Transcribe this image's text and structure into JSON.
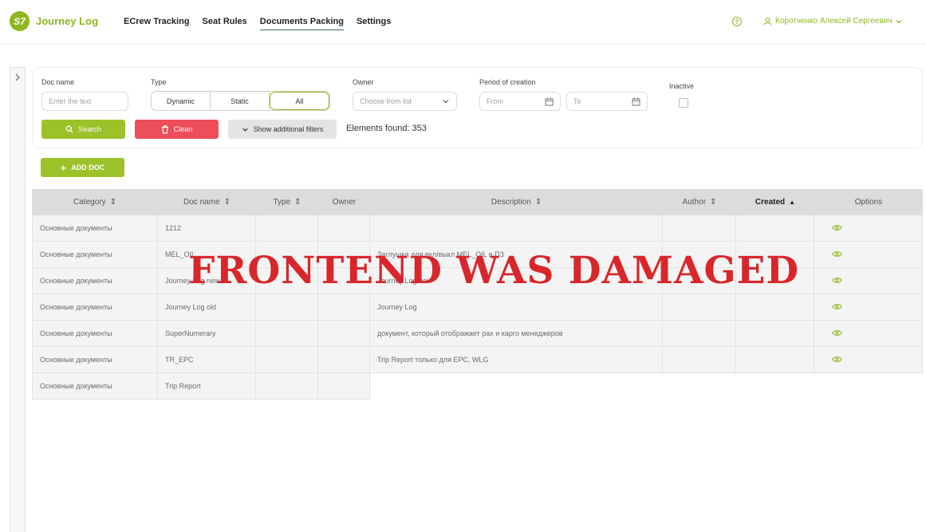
{
  "header": {
    "logo": "S7",
    "app_title": "Journey Log",
    "nav": [
      "ECrew Tracking",
      "Seat Rules",
      "Documents Packing",
      "Settings"
    ],
    "active_nav": "Documents Packing",
    "help_icon": "?",
    "user_name": "Коротченко Алексей Сергеевич",
    "brand_color": "#8cb81e"
  },
  "filters": {
    "doc_name_label": "Doc name",
    "doc_name_placeholder": "Enter the text",
    "type_label": "Type",
    "type_options": [
      "Dynamic",
      "Static",
      "All"
    ],
    "type_selected": "All",
    "owner_label": "Owner",
    "owner_placeholder": "Choose from list",
    "period_label": "Period of creation",
    "from_placeholder": "From",
    "to_placeholder": "To",
    "inactive_label": "Inactive",
    "search_label": "Search",
    "clean_label": "Clean",
    "more_label": "Show additional filters",
    "found_text": "Elements found: 353"
  },
  "add_doc_label": "ADD DOC",
  "table": {
    "columns": [
      "Category",
      "Doc name",
      "Type",
      "Owner",
      "Description",
      "Author",
      "Created",
      "Options"
    ],
    "rows": [
      {
        "category": "Основные документы",
        "doc_name": "1212",
        "description": "",
        "has_view": true
      },
      {
        "category": "Основные документы",
        "doc_name": "MEL_OIL",
        "description": "Заглушка для вкл/выкл MEL_OIL в ПЗ",
        "has_view": true
      },
      {
        "category": "Основные документы",
        "doc_name": "Journey Log new",
        "description": "Journey Log new",
        "has_view": true
      },
      {
        "category": "Основные документы",
        "doc_name": "Journey Log old",
        "description": "Journey Log",
        "has_view": true
      },
      {
        "category": "Основные документы",
        "doc_name": "SuperNumerary",
        "description": "документ, который отображает pax и карго менеджеров",
        "has_view": true
      },
      {
        "category": "Основные документы",
        "doc_name": "TR_EPC",
        "description": "Trip Report только для EPC, WLG",
        "has_view": true
      },
      {
        "category": "Основные документы",
        "doc_name": "Trip Report",
        "description": "",
        "has_view": false
      }
    ]
  },
  "watermark": "FRONTEND WAS DAMAGED",
  "colors": {
    "accent": "#8cb81e",
    "danger": "#ec4e5a",
    "watermark": "#d8262a"
  }
}
